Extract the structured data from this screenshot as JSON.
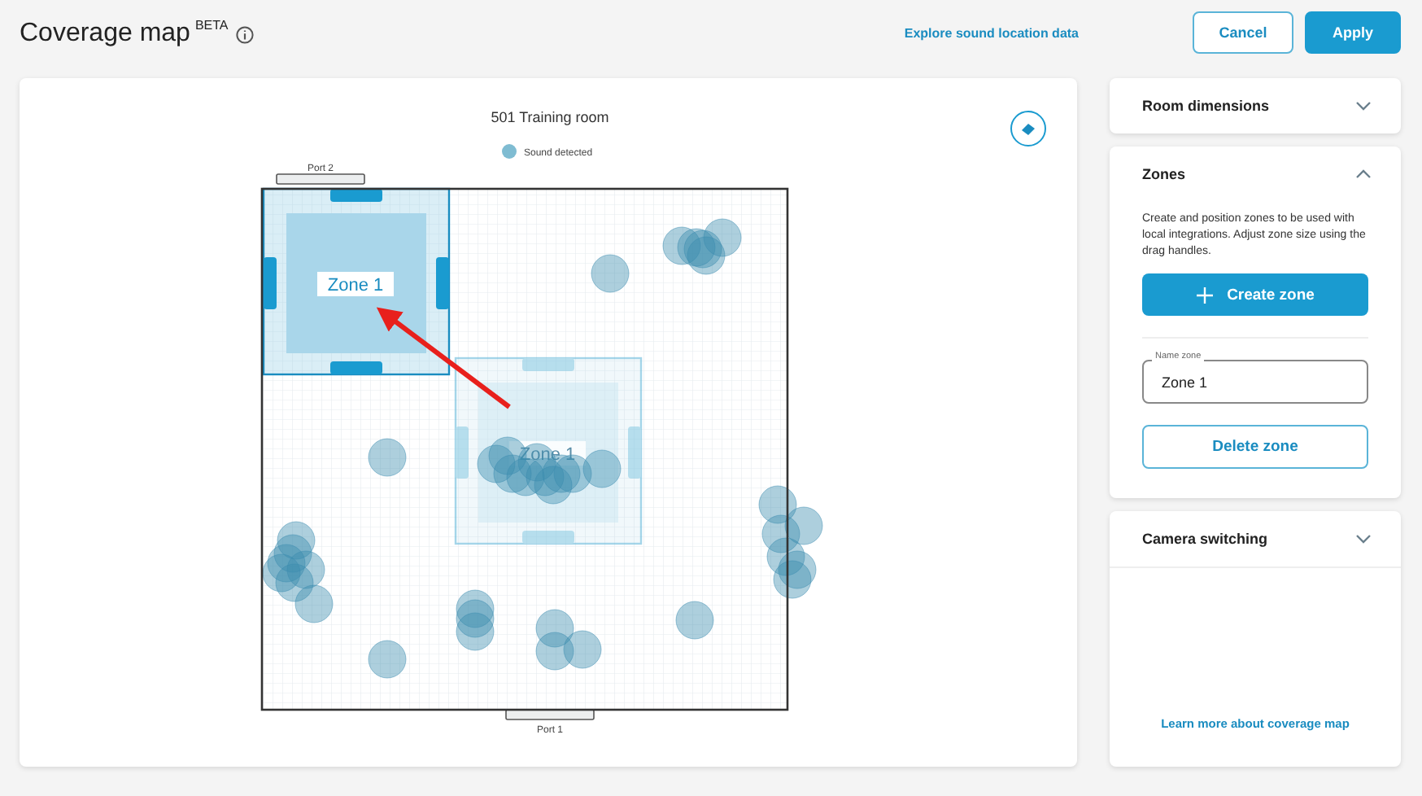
{
  "header": {
    "title": "Coverage map",
    "badge": "BETA",
    "link": "Explore sound location data",
    "buttons": [
      {
        "label": "Cancel",
        "kind": "secondary"
      },
      {
        "label": "Apply",
        "kind": "primary"
      }
    ]
  },
  "map": {
    "title": "501 Training room",
    "legend": "Sound detected",
    "ports": [
      "Port 2",
      "Port 1"
    ],
    "zones": [
      {
        "name": "Zone 1",
        "selected": true
      },
      {
        "name": "Zone 1",
        "selected": false
      }
    ]
  },
  "sections": [
    {
      "title": "Room dimensions",
      "expanded": false
    },
    {
      "title": "Zones",
      "expanded": true,
      "description": "Create and position zones to be used with local integrations. Adjust zone size using the drag handles.",
      "create_button": "Create zone",
      "name_field": {
        "label": "Name zone",
        "value": "Zone 1"
      },
      "delete_button": "Delete zone"
    },
    {
      "title": "Camera switching",
      "expanded": false,
      "footer_link": "Learn more about coverage map"
    }
  ]
}
